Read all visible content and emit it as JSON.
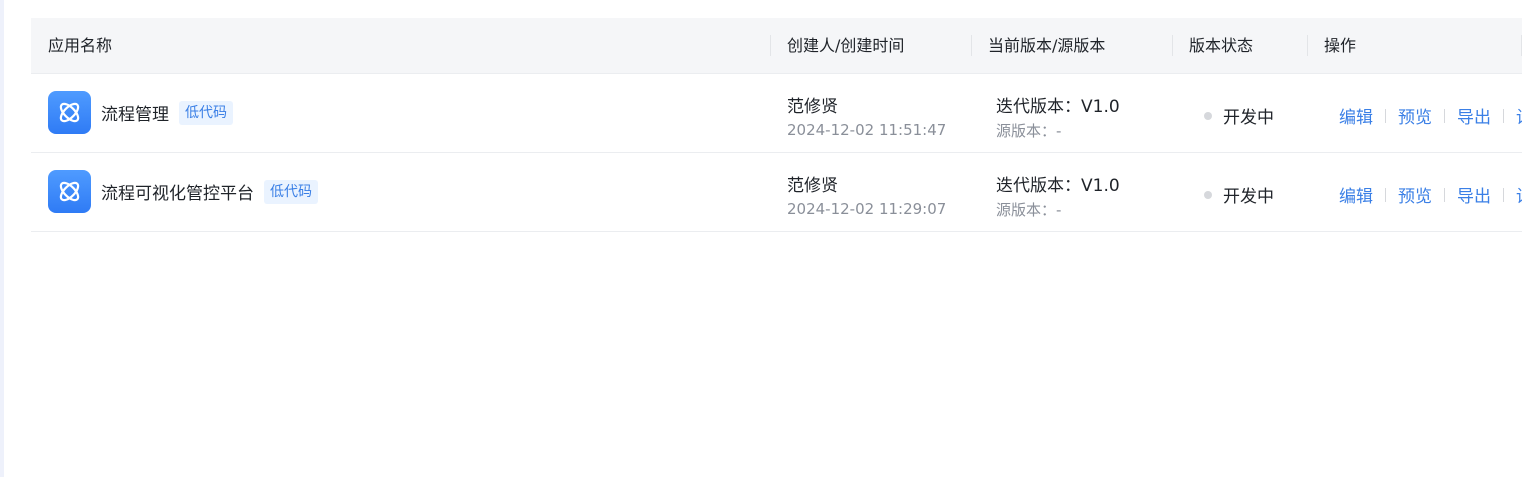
{
  "table": {
    "headers": {
      "app_name": "应用名称",
      "creator_time": "创建人/创建时间",
      "version": "当前版本/源版本",
      "status": "版本状态",
      "actions": "操作"
    },
    "rows": [
      {
        "app_name": "流程管理",
        "tag": "低代码",
        "creator": "范修贤",
        "created_time": "2024-12-02 11:51:47",
        "version": "迭代版本：V1.0",
        "source_version": "源版本：-",
        "status": "开发中",
        "actions": [
          "编辑",
          "预览",
          "导出",
          "设"
        ]
      },
      {
        "app_name": "流程可视化管控平台",
        "tag": "低代码",
        "creator": "范修贤",
        "created_time": "2024-12-02 11:29:07",
        "version": "迭代版本：V1.0",
        "source_version": "源版本：-",
        "status": "开发中",
        "actions": [
          "编辑",
          "预览",
          "导出",
          "设"
        ]
      }
    ]
  },
  "icons": {
    "app_icon": "atom-icon",
    "status_dot": "status-dot-icon"
  },
  "colors": {
    "accent": "#3a7fe6",
    "app_icon_bg": "#2f7bf5",
    "header_bg": "#f5f6f8",
    "status_dot": "#d6d8dc"
  }
}
